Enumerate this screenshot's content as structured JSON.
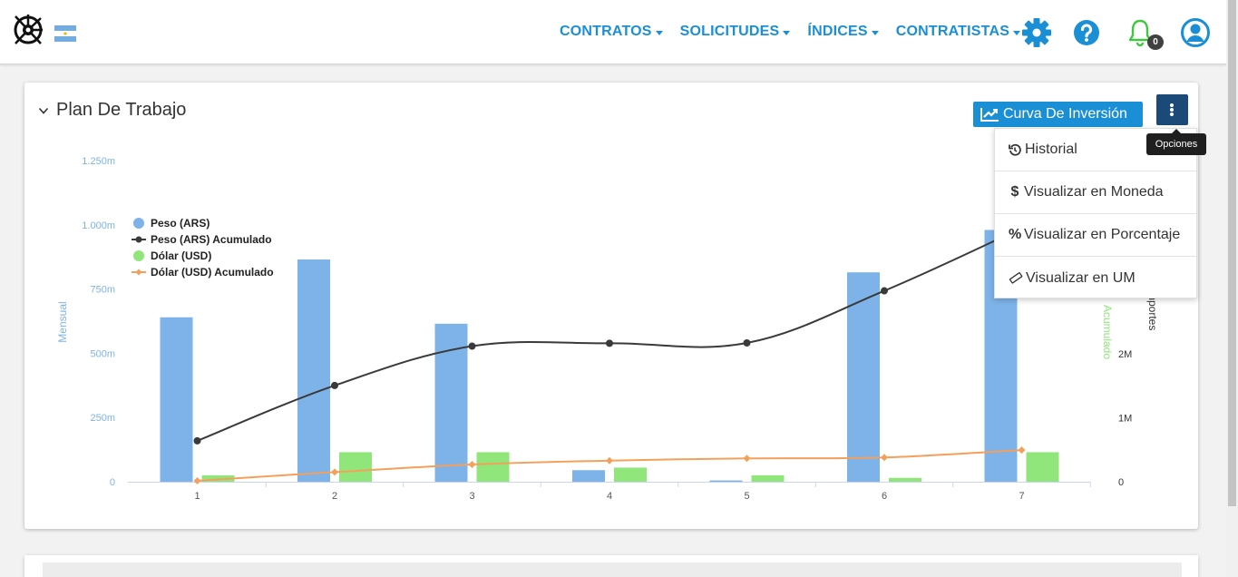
{
  "nav": {
    "items": [
      {
        "label": "CONTRATOS"
      },
      {
        "label": "SOLICITUDES"
      },
      {
        "label": "ÍNDICES"
      },
      {
        "label": "CONTRATISTAS"
      }
    ],
    "notifications_count": "0"
  },
  "card": {
    "title": "Plan De Trabajo",
    "curva_button": "Curva De Inversión",
    "options_tooltip": "Opciones"
  },
  "dropdown": {
    "items": [
      {
        "icon": "history-icon",
        "label": "Historial"
      },
      {
        "icon": "dollar-icon",
        "label": "Visualizar en Moneda"
      },
      {
        "icon": "percent-icon",
        "label": "Visualizar en Porcentaje"
      },
      {
        "icon": "ruler-icon",
        "label": "Visualizar en UM"
      }
    ]
  },
  "colors": {
    "accent": "#1a8fd6",
    "options_button": "#1c4a78",
    "ars_bar": "#7db3e8",
    "ars_line": "#3a3a3a",
    "usd_bar": "#90e67b",
    "usd_line": "#f5a05a"
  },
  "chart_data": {
    "type": "bar",
    "categories": [
      "1",
      "2",
      "3",
      "4",
      "5",
      "6",
      "7"
    ],
    "y_left": {
      "label": "Mensual",
      "ticks": [
        "0",
        "250m",
        "500m",
        "750m",
        "1.000m",
        "1.250m"
      ],
      "ylim": [
        0,
        1250000000
      ]
    },
    "y_right_green": {
      "label": "Acumulado"
    },
    "y_right": {
      "label": "Importes",
      "ticks": [
        "0",
        "1M",
        "2M"
      ]
    },
    "legend_position": "top-left",
    "series": [
      {
        "name": "Peso (ARS)",
        "type": "bar",
        "values": [
          640000000,
          865000000,
          615000000,
          45000000,
          5000000,
          815000000,
          980000000
        ]
      },
      {
        "name": "Peso (ARS) Acumulado",
        "type": "line",
        "values": [
          640000,
          1505000,
          2120000,
          2165000,
          2170000,
          2985000,
          3965000
        ]
      },
      {
        "name": "Dólar (USD)",
        "type": "bar",
        "values": [
          25000000,
          115000000,
          115000000,
          55000000,
          25000000,
          15000000,
          115000000
        ]
      },
      {
        "name": "Dólar (USD) Acumulado",
        "type": "line",
        "values": [
          15000,
          150000,
          270000,
          330000,
          365000,
          380000,
          495000
        ]
      }
    ]
  }
}
